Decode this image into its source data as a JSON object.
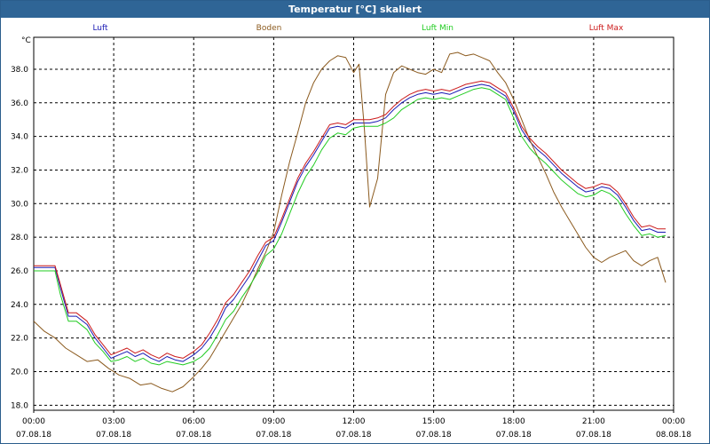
{
  "window": {
    "title": "Temperatur [°C] skaliert"
  },
  "chart_data": {
    "type": "line",
    "title": "Temperatur [°C] skaliert",
    "ylabel": "°C",
    "ylim": [
      17.7,
      39.9
    ],
    "xlim": [
      0,
      24
    ],
    "yticks": [
      "18.0",
      "20.0",
      "22.0",
      "24.0",
      "26.0",
      "28.0",
      "30.0",
      "32.0",
      "34.0",
      "36.0",
      "38.0"
    ],
    "xticks": [
      {
        "time": "00:00",
        "date": "07.08.18"
      },
      {
        "time": "03:00",
        "date": "07.08.18"
      },
      {
        "time": "06:00",
        "date": "07.08.18"
      },
      {
        "time": "09:00",
        "date": "07.08.18"
      },
      {
        "time": "12:00",
        "date": "07.08.18"
      },
      {
        "time": "15:00",
        "date": "07.08.18"
      },
      {
        "time": "18:00",
        "date": "07.08.18"
      },
      {
        "time": "21:00",
        "date": "07.08.18"
      },
      {
        "time": "00:00",
        "date": "08.08.18"
      }
    ],
    "grid": true,
    "legend_position": "top",
    "series": [
      {
        "name": "Luft",
        "color": "#1a1ab4",
        "x": [
          0,
          0.5,
          0.8,
          1.0,
          1.3,
          1.6,
          2.0,
          2.3,
          2.6,
          2.9,
          3.2,
          3.5,
          3.8,
          4.1,
          4.4,
          4.7,
          5.0,
          5.3,
          5.6,
          6.0,
          6.3,
          6.6,
          6.9,
          7.2,
          7.5,
          7.8,
          8.1,
          8.4,
          8.7,
          9.0,
          9.3,
          9.6,
          9.9,
          10.2,
          10.5,
          10.8,
          11.1,
          11.4,
          11.7,
          12.0,
          12.3,
          12.6,
          12.9,
          13.2,
          13.5,
          13.8,
          14.1,
          14.4,
          14.7,
          15.0,
          15.3,
          15.6,
          15.9,
          16.2,
          16.5,
          16.8,
          17.1,
          17.4,
          17.7,
          18.0,
          18.3,
          18.6,
          18.9,
          19.2,
          19.5,
          19.8,
          20.1,
          20.4,
          20.7,
          21.0,
          21.3,
          21.6,
          21.9,
          22.2,
          22.5,
          22.8,
          23.1,
          23.4,
          23.7
        ],
        "values": [
          26.2,
          26.2,
          26.2,
          25.0,
          23.3,
          23.3,
          22.8,
          22.0,
          21.4,
          20.8,
          21.0,
          21.2,
          20.9,
          21.1,
          20.8,
          20.6,
          20.9,
          20.7,
          20.6,
          21.0,
          21.4,
          22.0,
          22.8,
          23.8,
          24.3,
          25.0,
          25.7,
          26.6,
          27.5,
          27.8,
          28.9,
          30.1,
          31.3,
          32.2,
          32.9,
          33.7,
          34.5,
          34.6,
          34.5,
          34.8,
          34.8,
          34.8,
          34.9,
          35.1,
          35.6,
          36.0,
          36.3,
          36.5,
          36.6,
          36.5,
          36.6,
          36.5,
          36.7,
          36.9,
          37.0,
          37.1,
          37.0,
          36.7,
          36.4,
          35.5,
          34.4,
          33.7,
          33.2,
          32.8,
          32.3,
          31.8,
          31.4,
          31.0,
          30.7,
          30.8,
          31.0,
          30.9,
          30.5,
          29.8,
          29.0,
          28.4,
          28.5,
          28.3,
          28.3
        ]
      },
      {
        "name": "Boden",
        "color": "#8b5a1e",
        "x": [
          0,
          0.4,
          0.8,
          1.2,
          1.6,
          2.0,
          2.4,
          2.8,
          3.2,
          3.6,
          4.0,
          4.4,
          4.8,
          5.2,
          5.6,
          6.0,
          6.3,
          6.6,
          6.9,
          7.2,
          7.5,
          7.8,
          8.1,
          8.4,
          8.7,
          9.0,
          9.3,
          9.6,
          9.9,
          10.2,
          10.5,
          10.8,
          11.1,
          11.4,
          11.7,
          12.0,
          12.2,
          12.4,
          12.6,
          12.9,
          13.2,
          13.5,
          13.8,
          14.1,
          14.4,
          14.7,
          15.0,
          15.3,
          15.6,
          15.9,
          16.2,
          16.5,
          16.8,
          17.1,
          17.4,
          17.7,
          18.0,
          18.3,
          18.6,
          18.9,
          19.2,
          19.5,
          19.8,
          20.1,
          20.4,
          20.7,
          21.0,
          21.3,
          21.6,
          21.9,
          22.2,
          22.5,
          22.8,
          23.1,
          23.4,
          23.7
        ],
        "values": [
          23.0,
          22.4,
          22.0,
          21.4,
          21.0,
          20.6,
          20.7,
          20.2,
          19.8,
          19.6,
          19.2,
          19.3,
          19.0,
          18.8,
          19.1,
          19.7,
          20.2,
          20.8,
          21.6,
          22.4,
          23.2,
          24.0,
          25.0,
          26.1,
          27.1,
          28.3,
          30.5,
          32.5,
          34.2,
          36.0,
          37.2,
          38.0,
          38.5,
          38.8,
          38.7,
          37.8,
          38.3,
          34.5,
          29.8,
          31.5,
          36.5,
          37.8,
          38.2,
          38.0,
          37.8,
          37.7,
          38.0,
          37.8,
          38.9,
          39.0,
          38.8,
          38.9,
          38.7,
          38.5,
          37.8,
          37.2,
          36.2,
          35.0,
          33.8,
          32.8,
          31.8,
          30.7,
          29.8,
          29.0,
          28.2,
          27.4,
          26.8,
          26.5,
          26.8,
          27.0,
          27.2,
          26.6,
          26.3,
          26.6,
          26.8,
          25.3
        ]
      },
      {
        "name": "Luft Min",
        "color": "#22cc22",
        "x": [
          0,
          0.5,
          0.8,
          1.0,
          1.3,
          1.6,
          2.0,
          2.3,
          2.6,
          2.9,
          3.2,
          3.5,
          3.8,
          4.1,
          4.4,
          4.7,
          5.0,
          5.3,
          5.6,
          6.0,
          6.3,
          6.6,
          6.9,
          7.2,
          7.5,
          7.8,
          8.1,
          8.4,
          8.7,
          9.0,
          9.3,
          9.6,
          9.9,
          10.2,
          10.5,
          10.8,
          11.1,
          11.4,
          11.7,
          12.0,
          12.3,
          12.6,
          12.9,
          13.2,
          13.5,
          13.8,
          14.1,
          14.4,
          14.7,
          15.0,
          15.3,
          15.6,
          15.9,
          16.2,
          16.5,
          16.8,
          17.1,
          17.4,
          17.7,
          18.0,
          18.3,
          18.6,
          18.9,
          19.2,
          19.5,
          19.8,
          20.1,
          20.4,
          20.7,
          21.0,
          21.3,
          21.6,
          21.9,
          22.2,
          22.5,
          22.8,
          23.1,
          23.4,
          23.7
        ],
        "values": [
          26.0,
          26.0,
          26.0,
          24.6,
          23.0,
          23.0,
          22.5,
          21.7,
          21.2,
          20.6,
          20.7,
          20.9,
          20.6,
          20.8,
          20.5,
          20.4,
          20.6,
          20.5,
          20.4,
          20.6,
          20.9,
          21.4,
          22.2,
          23.1,
          23.6,
          24.4,
          25.1,
          25.9,
          26.9,
          27.3,
          28.2,
          29.4,
          30.6,
          31.6,
          32.3,
          33.2,
          33.9,
          34.2,
          34.1,
          34.5,
          34.6,
          34.6,
          34.6,
          34.8,
          35.1,
          35.6,
          35.9,
          36.2,
          36.3,
          36.2,
          36.3,
          36.2,
          36.4,
          36.6,
          36.8,
          36.9,
          36.8,
          36.5,
          36.2,
          35.1,
          34.0,
          33.3,
          32.8,
          32.4,
          31.9,
          31.4,
          31.0,
          30.6,
          30.4,
          30.5,
          30.8,
          30.6,
          30.2,
          29.4,
          28.7,
          28.1,
          28.2,
          28.0,
          28.1
        ]
      },
      {
        "name": "Luft Max",
        "color": "#cc1a1a",
        "x": [
          0,
          0.5,
          0.8,
          1.0,
          1.3,
          1.6,
          2.0,
          2.3,
          2.6,
          2.9,
          3.2,
          3.5,
          3.8,
          4.1,
          4.4,
          4.7,
          5.0,
          5.3,
          5.6,
          6.0,
          6.3,
          6.6,
          6.9,
          7.2,
          7.5,
          7.8,
          8.1,
          8.4,
          8.7,
          9.0,
          9.3,
          9.6,
          9.9,
          10.2,
          10.5,
          10.8,
          11.1,
          11.4,
          11.7,
          12.0,
          12.3,
          12.6,
          12.9,
          13.2,
          13.5,
          13.8,
          14.1,
          14.4,
          14.7,
          15.0,
          15.3,
          15.6,
          15.9,
          16.2,
          16.5,
          16.8,
          17.1,
          17.4,
          17.7,
          18.0,
          18.3,
          18.6,
          18.9,
          19.2,
          19.5,
          19.8,
          20.1,
          20.4,
          20.7,
          21.0,
          21.3,
          21.6,
          21.9,
          22.2,
          22.5,
          22.8,
          23.1,
          23.4,
          23.7
        ],
        "values": [
          26.3,
          26.3,
          26.3,
          25.2,
          23.5,
          23.5,
          23.0,
          22.2,
          21.6,
          21.0,
          21.2,
          21.4,
          21.1,
          21.3,
          21.0,
          20.8,
          21.1,
          20.9,
          20.8,
          21.2,
          21.6,
          22.3,
          23.1,
          24.1,
          24.6,
          25.3,
          26.0,
          26.9,
          27.7,
          28.0,
          29.1,
          30.3,
          31.5,
          32.4,
          33.1,
          33.9,
          34.7,
          34.8,
          34.7,
          35.0,
          35.0,
          35.0,
          35.1,
          35.3,
          35.8,
          36.2,
          36.5,
          36.7,
          36.8,
          36.7,
          36.8,
          36.7,
          36.9,
          37.1,
          37.2,
          37.3,
          37.2,
          36.9,
          36.6,
          35.7,
          34.6,
          33.9,
          33.4,
          33.0,
          32.5,
          32.0,
          31.6,
          31.2,
          30.9,
          31.0,
          31.2,
          31.1,
          30.7,
          30.0,
          29.2,
          28.6,
          28.7,
          28.5,
          28.5
        ]
      }
    ]
  }
}
